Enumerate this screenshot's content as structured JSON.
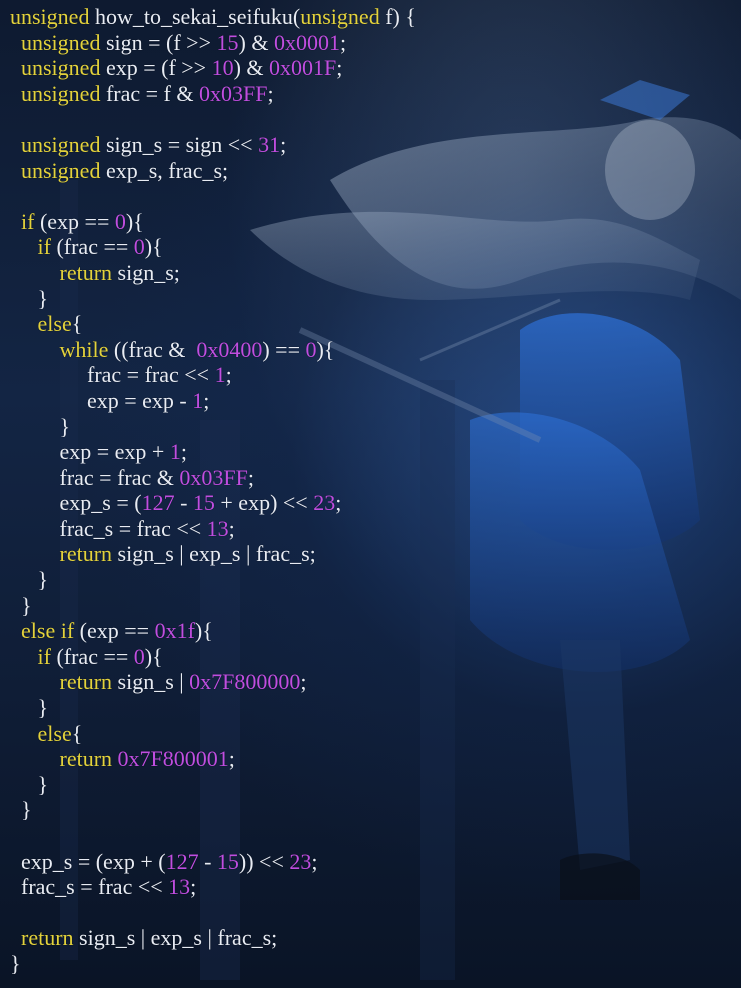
{
  "editor": {
    "background": "anime illustration (blue, dark) behind code",
    "colors": {
      "keyword": "#e3d23c",
      "number": "#c04ee0",
      "text": "#e8ecf4",
      "background": "#0f1a2e"
    }
  },
  "code_lines": [
    [
      {
        "t": "kw",
        "v": "unsigned"
      },
      {
        "t": "id",
        "v": " how_to_sekai_seifuku("
      },
      {
        "t": "kw",
        "v": "unsigned"
      },
      {
        "t": "id",
        "v": " f) {"
      }
    ],
    [
      {
        "t": "id",
        "v": "  "
      },
      {
        "t": "kw",
        "v": "unsigned"
      },
      {
        "t": "id",
        "v": " sign = (f >> "
      },
      {
        "t": "num",
        "v": "15"
      },
      {
        "t": "id",
        "v": ") & "
      },
      {
        "t": "num",
        "v": "0x0001"
      },
      {
        "t": "id",
        "v": ";"
      }
    ],
    [
      {
        "t": "id",
        "v": "  "
      },
      {
        "t": "kw",
        "v": "unsigned"
      },
      {
        "t": "id",
        "v": " exp = (f >> "
      },
      {
        "t": "num",
        "v": "10"
      },
      {
        "t": "id",
        "v": ") & "
      },
      {
        "t": "num",
        "v": "0x001F"
      },
      {
        "t": "id",
        "v": ";"
      }
    ],
    [
      {
        "t": "id",
        "v": "  "
      },
      {
        "t": "kw",
        "v": "unsigned"
      },
      {
        "t": "id",
        "v": " frac = f & "
      },
      {
        "t": "num",
        "v": "0x03FF"
      },
      {
        "t": "id",
        "v": ";"
      }
    ],
    [],
    [
      {
        "t": "id",
        "v": "  "
      },
      {
        "t": "kw",
        "v": "unsigned"
      },
      {
        "t": "id",
        "v": " sign_s = sign << "
      },
      {
        "t": "num",
        "v": "31"
      },
      {
        "t": "id",
        "v": ";"
      }
    ],
    [
      {
        "t": "id",
        "v": "  "
      },
      {
        "t": "kw",
        "v": "unsigned"
      },
      {
        "t": "id",
        "v": " exp_s, frac_s;"
      }
    ],
    [],
    [
      {
        "t": "id",
        "v": "  "
      },
      {
        "t": "kw",
        "v": "if"
      },
      {
        "t": "id",
        "v": " (exp == "
      },
      {
        "t": "num",
        "v": "0"
      },
      {
        "t": "id",
        "v": "){"
      }
    ],
    [
      {
        "t": "id",
        "v": "     "
      },
      {
        "t": "kw",
        "v": "if"
      },
      {
        "t": "id",
        "v": " (frac == "
      },
      {
        "t": "num",
        "v": "0"
      },
      {
        "t": "id",
        "v": "){"
      }
    ],
    [
      {
        "t": "id",
        "v": "         "
      },
      {
        "t": "kw",
        "v": "return"
      },
      {
        "t": "id",
        "v": " sign_s;"
      }
    ],
    [
      {
        "t": "id",
        "v": "     }"
      }
    ],
    [
      {
        "t": "id",
        "v": "     "
      },
      {
        "t": "kw",
        "v": "else"
      },
      {
        "t": "id",
        "v": "{"
      }
    ],
    [
      {
        "t": "id",
        "v": "         "
      },
      {
        "t": "kw",
        "v": "while"
      },
      {
        "t": "id",
        "v": " ((frac &  "
      },
      {
        "t": "num",
        "v": "0x0400"
      },
      {
        "t": "id",
        "v": ") == "
      },
      {
        "t": "num",
        "v": "0"
      },
      {
        "t": "id",
        "v": "){"
      }
    ],
    [
      {
        "t": "id",
        "v": "              frac = frac << "
      },
      {
        "t": "num",
        "v": "1"
      },
      {
        "t": "id",
        "v": ";"
      }
    ],
    [
      {
        "t": "id",
        "v": "              exp = exp - "
      },
      {
        "t": "num",
        "v": "1"
      },
      {
        "t": "id",
        "v": ";"
      }
    ],
    [
      {
        "t": "id",
        "v": "         }"
      }
    ],
    [
      {
        "t": "id",
        "v": "         exp = exp + "
      },
      {
        "t": "num",
        "v": "1"
      },
      {
        "t": "id",
        "v": ";"
      }
    ],
    [
      {
        "t": "id",
        "v": "         frac = frac & "
      },
      {
        "t": "num",
        "v": "0x03FF"
      },
      {
        "t": "id",
        "v": ";"
      }
    ],
    [
      {
        "t": "id",
        "v": "         exp_s = ("
      },
      {
        "t": "num",
        "v": "127"
      },
      {
        "t": "id",
        "v": " - "
      },
      {
        "t": "num",
        "v": "15"
      },
      {
        "t": "id",
        "v": " + exp) << "
      },
      {
        "t": "num",
        "v": "23"
      },
      {
        "t": "id",
        "v": ";"
      }
    ],
    [
      {
        "t": "id",
        "v": "         frac_s = frac << "
      },
      {
        "t": "num",
        "v": "13"
      },
      {
        "t": "id",
        "v": ";"
      }
    ],
    [
      {
        "t": "id",
        "v": "         "
      },
      {
        "t": "kw",
        "v": "return"
      },
      {
        "t": "id",
        "v": " sign_s | exp_s | frac_s;"
      }
    ],
    [
      {
        "t": "id",
        "v": "     }"
      }
    ],
    [
      {
        "t": "id",
        "v": "  }"
      }
    ],
    [
      {
        "t": "id",
        "v": "  "
      },
      {
        "t": "kw",
        "v": "else if"
      },
      {
        "t": "id",
        "v": " (exp == "
      },
      {
        "t": "num",
        "v": "0x1f"
      },
      {
        "t": "id",
        "v": "){"
      }
    ],
    [
      {
        "t": "id",
        "v": "     "
      },
      {
        "t": "kw",
        "v": "if"
      },
      {
        "t": "id",
        "v": " (frac == "
      },
      {
        "t": "num",
        "v": "0"
      },
      {
        "t": "id",
        "v": "){"
      }
    ],
    [
      {
        "t": "id",
        "v": "         "
      },
      {
        "t": "kw",
        "v": "return"
      },
      {
        "t": "id",
        "v": " sign_s | "
      },
      {
        "t": "num",
        "v": "0x7F800000"
      },
      {
        "t": "id",
        "v": ";"
      }
    ],
    [
      {
        "t": "id",
        "v": "     }"
      }
    ],
    [
      {
        "t": "id",
        "v": "     "
      },
      {
        "t": "kw",
        "v": "else"
      },
      {
        "t": "id",
        "v": "{"
      }
    ],
    [
      {
        "t": "id",
        "v": "         "
      },
      {
        "t": "kw",
        "v": "return"
      },
      {
        "t": "id",
        "v": " "
      },
      {
        "t": "num",
        "v": "0x7F800001"
      },
      {
        "t": "id",
        "v": ";"
      }
    ],
    [
      {
        "t": "id",
        "v": "     }"
      }
    ],
    [
      {
        "t": "id",
        "v": "  }"
      }
    ],
    [],
    [
      {
        "t": "id",
        "v": "  exp_s = (exp + ("
      },
      {
        "t": "num",
        "v": "127"
      },
      {
        "t": "id",
        "v": " - "
      },
      {
        "t": "num",
        "v": "15"
      },
      {
        "t": "id",
        "v": ")) << "
      },
      {
        "t": "num",
        "v": "23"
      },
      {
        "t": "id",
        "v": ";"
      }
    ],
    [
      {
        "t": "id",
        "v": "  frac_s = frac << "
      },
      {
        "t": "num",
        "v": "13"
      },
      {
        "t": "id",
        "v": ";"
      }
    ],
    [],
    [
      {
        "t": "id",
        "v": "  "
      },
      {
        "t": "kw",
        "v": "return"
      },
      {
        "t": "id",
        "v": " sign_s | exp_s | frac_s;"
      }
    ],
    [
      {
        "t": "id",
        "v": "}"
      }
    ]
  ]
}
